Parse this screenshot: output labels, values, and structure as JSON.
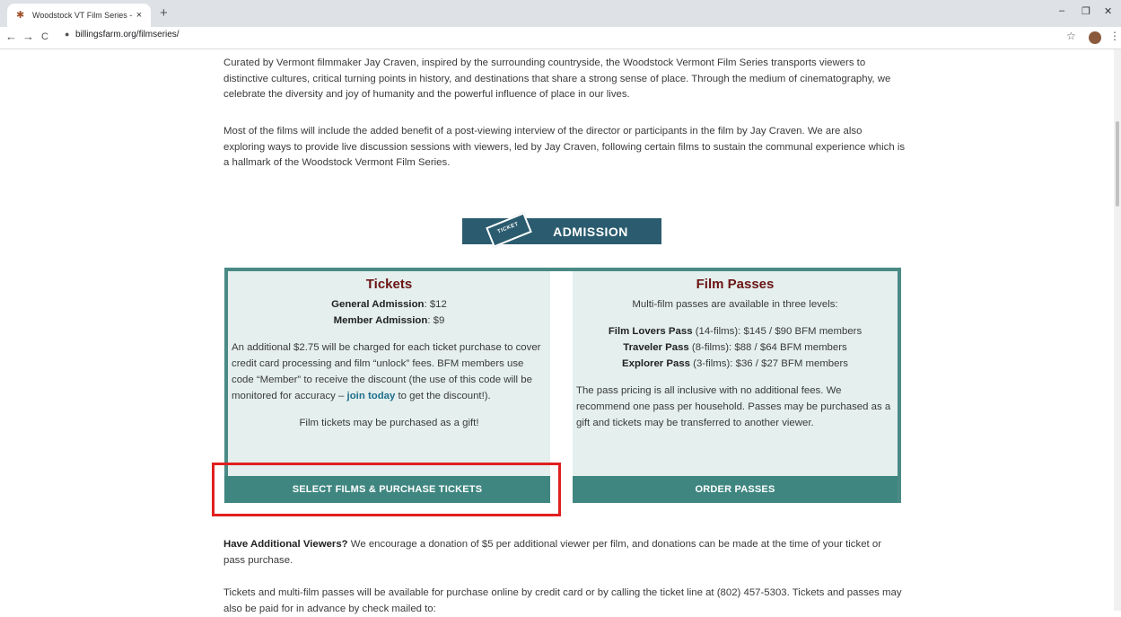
{
  "browser": {
    "tab_title": "Woodstock VT Film Series - Billin",
    "tab_close": "×",
    "new_tab": "+",
    "url": "billingsfarm.org/filmseries/",
    "minimize": "–",
    "restore": "❐",
    "close": "✕",
    "back": "←",
    "forward": "→",
    "reload": "C",
    "lock": "🔒",
    "star": "☆",
    "menu": "⋮"
  },
  "intro": {
    "p1": "Curated by Vermont filmmaker Jay Craven, inspired by the surrounding countryside, the Woodstock Vermont Film Series transports viewers to distinctive cultures, critical turning points in history, and destinations that share a strong sense of place. Through the medium of cinematography, we celebrate the diversity and joy of humanity and the powerful influence of place in our lives.",
    "p2": "Most of the films will include the added benefit of a post-viewing interview of the director or participants in the film by Jay Craven. We are also exploring ways to provide live discussion sessions with viewers, led by Jay Craven, following certain films to sustain the communal experience which is a hallmark of the Woodstock Vermont Film Series."
  },
  "admission": {
    "title": "ADMISSION",
    "ticket_label": "TICKET"
  },
  "tickets": {
    "heading": "Tickets",
    "general_label": "General Admission",
    "general_price": ": $12",
    "member_label": "Member Admission",
    "member_price": ": $9",
    "fee_text_1": "An additional $2.75 will be charged for each ticket purchase to cover credit card processing and film “unlock” fees. BFM members use code “Member” to receive the discount (the use of this code will be monitored for accuracy – ",
    "join_link": "join today",
    "fee_text_2": " to get the discount!).",
    "gift_text": "Film tickets may be purchased as a gift!",
    "button": "SELECT FILMS & PURCHASE TICKETS"
  },
  "passes": {
    "heading": "Film Passes",
    "intro": "Multi-film passes are available in three levels:",
    "items": [
      {
        "name": "Film Lovers Pass",
        "detail": " (14-films): $145 / $90 BFM members"
      },
      {
        "name": "Traveler Pass",
        "detail": " (8-films): $88 / $64 BFM members"
      },
      {
        "name": "Explorer Pass",
        "detail": " (3-films): $36 / $27 BFM members"
      }
    ],
    "note": "The pass pricing is all inclusive with no additional fees. We recommend one pass per household. Passes may be purchased as a gift and tickets may be transferred to another viewer.",
    "button": "ORDER PASSES"
  },
  "additional": {
    "bold": "Have Additional Viewers?",
    "text": " We encourage a donation of $5 per additional viewer per film, and donations can be made at the time of your ticket or pass purchase."
  },
  "purchase_info": "Tickets and multi-film passes will be available for purchase online by credit card or by calling the ticket line at (802) 457-5303. Tickets and passes may also be paid for in advance by check mailed to:"
}
